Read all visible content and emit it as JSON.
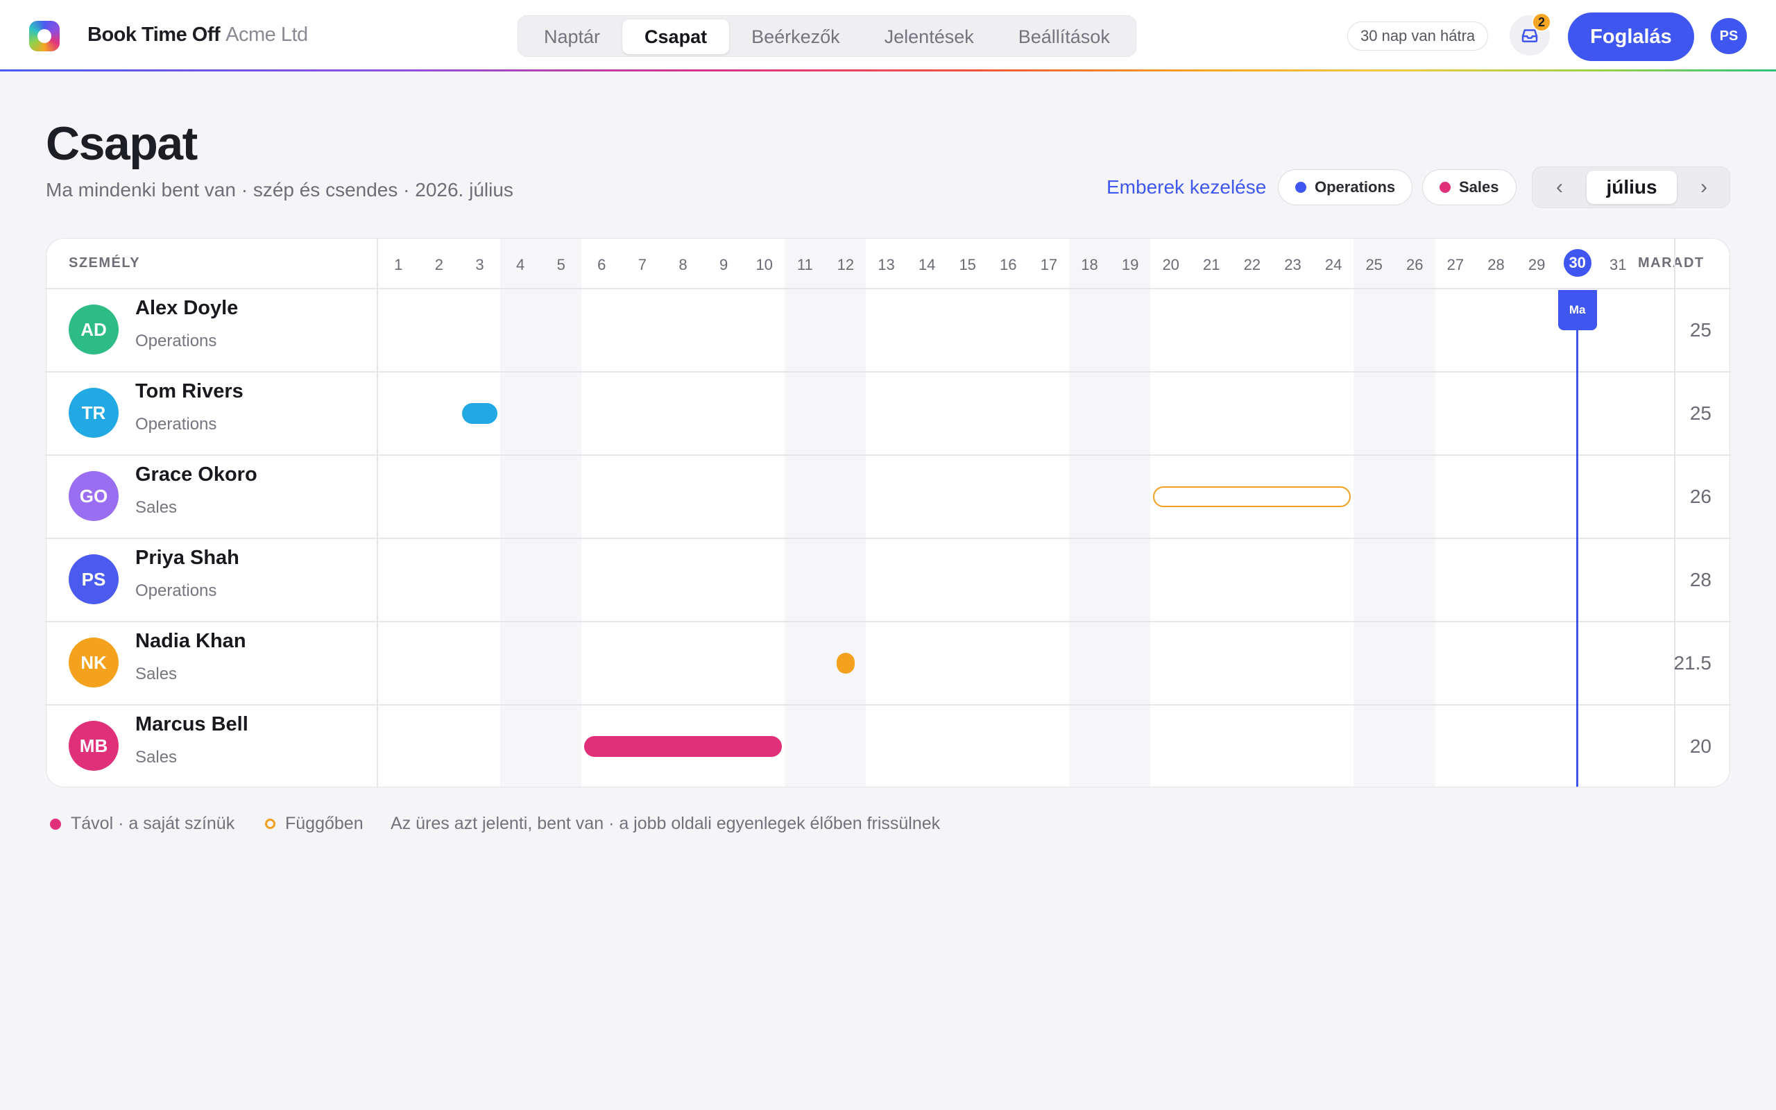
{
  "header": {
    "brand": "Book Time Off",
    "company": "Acme Ltd",
    "tabs": [
      {
        "label": "Naptár",
        "active": false
      },
      {
        "label": "Csapat",
        "active": true
      },
      {
        "label": "Beérkezők",
        "active": false
      },
      {
        "label": "Jelentések",
        "active": false
      },
      {
        "label": "Beállítások",
        "active": false
      }
    ],
    "trial": "30 nap van hátra",
    "inbox_badge": "2",
    "book_button": "Foglalás",
    "user_initials": "PS"
  },
  "page": {
    "title": "Csapat",
    "subtitle": "Ma mindenki bent van · szép és csendes · 2026. július",
    "manage_link": "Emberek kezelése",
    "legend": [
      {
        "label": "Operations",
        "color": "#3f56f0"
      },
      {
        "label": "Sales",
        "color": "#e0307a"
      }
    ],
    "month": "július",
    "prev_icon": "‹",
    "next_icon": "›"
  },
  "grid": {
    "col_person": "SZEMÉLY",
    "col_remaining": "MARADT",
    "days": [
      1,
      2,
      3,
      4,
      5,
      6,
      7,
      8,
      9,
      10,
      11,
      12,
      13,
      14,
      15,
      16,
      17,
      18,
      19,
      20,
      21,
      22,
      23,
      24,
      25,
      26,
      27,
      28,
      29,
      30,
      31
    ],
    "weekend_days": [
      4,
      5,
      11,
      12,
      18,
      19,
      25,
      26
    ],
    "today": 30,
    "today_label": "Ma",
    "people": [
      {
        "initials": "AD",
        "name": "Alex Doyle",
        "team": "Operations",
        "avatar_color": "#2dbd84",
        "remaining": "25",
        "leaves": []
      },
      {
        "initials": "TR",
        "name": "Tom Rivers",
        "team": "Operations",
        "avatar_color": "#22a8e3",
        "remaining": "25",
        "leaves": [
          {
            "start": 3,
            "end": 3,
            "status": "approved",
            "color": "#22a8e3"
          }
        ]
      },
      {
        "initials": "GO",
        "name": "Grace Okoro",
        "team": "Sales",
        "avatar_color": "#9a6ef0",
        "remaining": "26",
        "leaves": [
          {
            "start": 20,
            "end": 24,
            "status": "pending",
            "color": "#f0a020"
          }
        ]
      },
      {
        "initials": "PS",
        "name": "Priya Shah",
        "team": "Operations",
        "avatar_color": "#4b5bf0",
        "remaining": "28",
        "leaves": []
      },
      {
        "initials": "NK",
        "name": "Nadia Khan",
        "team": "Sales",
        "avatar_color": "#f4a21e",
        "remaining": "21.5",
        "leaves": [
          {
            "start": 12,
            "end": 12,
            "status": "half",
            "color": "#f4a21e"
          }
        ]
      },
      {
        "initials": "MB",
        "name": "Marcus Bell",
        "team": "Sales",
        "avatar_color": "#e0307a",
        "remaining": "20",
        "leaves": [
          {
            "start": 6,
            "end": 10,
            "status": "approved",
            "color": "#e0307a"
          }
        ]
      }
    ]
  },
  "footer": {
    "away": "Távol · a saját színük",
    "away_color": "#e0307a",
    "pending": "Függőben",
    "pending_color": "#f0a020",
    "note": "Az üres azt jelenti, bent van · a jobb oldali egyenlegek élőben frissülnek"
  }
}
